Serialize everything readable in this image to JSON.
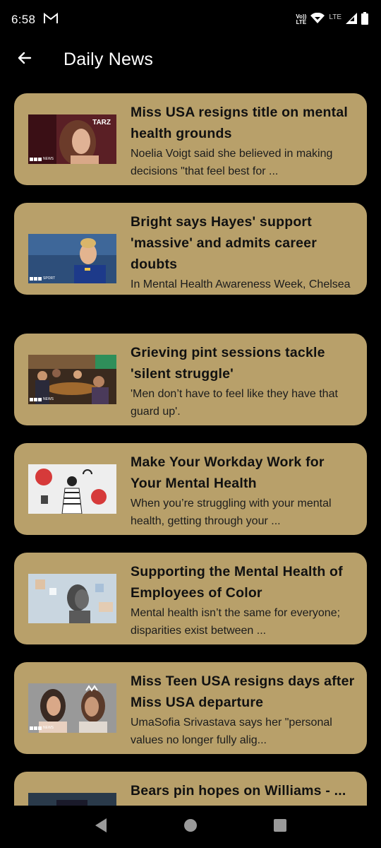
{
  "status_bar": {
    "time": "6:58",
    "network_top": "Vo))",
    "network_bottom": "LTE",
    "lte_label": "LTE"
  },
  "app_bar": {
    "title": "Daily News",
    "back_icon": "arrow-left-icon"
  },
  "articles": [
    {
      "title": "Miss USA resigns title on mental health grounds",
      "description": "Noelia Voigt said she believed in making decisions \"that feel best for ...",
      "thumb_text": "TARZ",
      "source_badge": "NEWS"
    },
    {
      "title": "Bright says Hayes' support 'massive' and admits career doubts",
      "description": "In Mental Health Awareness Week, Chelsea captain Millie Bright offers ...",
      "source_badge": "SPORT"
    },
    {
      "title": "Grieving pint sessions tackle 'silent struggle'",
      "description": "'Men don’t have to feel like they have that guard up'.",
      "source_badge": "NEWS"
    },
    {
      "title": "Make Your Workday Work for Your Mental Health",
      "description": "When you’re struggling with your mental health, getting through your ..."
    },
    {
      "title": "Supporting the Mental Health of Employees of Color",
      "description": "Mental health isn’t the same for everyone; disparities exist between ..."
    },
    {
      "title": "Miss Teen USA resigns days after Miss USA departure",
      "description": "UmaSofia Srivastava says her \"personal values no longer fully alig...",
      "source_badge": "NEWS"
    },
    {
      "title": "Bears pin hopes on Williams - ...",
      "description": ""
    }
  ],
  "nav_bar": {
    "back": "triangle-back-icon",
    "home": "circle-home-icon",
    "recents": "square-recents-icon"
  },
  "colors": {
    "background": "#000000",
    "card": "#b8a06a",
    "card_title": "#111111"
  }
}
